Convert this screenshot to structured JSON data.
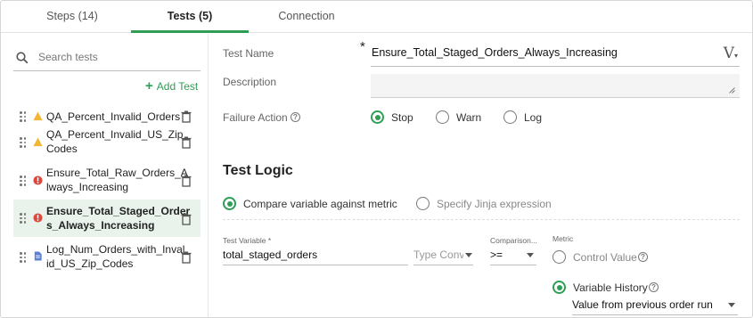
{
  "tabs": [
    {
      "label": "Steps (14)",
      "active": false
    },
    {
      "label": "Tests (5)",
      "active": true
    },
    {
      "label": "Connection",
      "active": false
    }
  ],
  "accent_color": "#2e9e55",
  "sidebar": {
    "search_placeholder": "Search tests",
    "add_test_label": "Add Test",
    "items": [
      {
        "line1": "QA_Percent_Invalid_Orders",
        "line2": "",
        "status": "warning",
        "selected": false
      },
      {
        "line1": "QA_Percent_Invalid_US_Zip_",
        "line2": "Codes",
        "status": "warning",
        "selected": false
      },
      {
        "line1": "Ensure_Total_Raw_Orders_A",
        "line2": "lways_Increasing",
        "status": "error",
        "selected": false
      },
      {
        "line1": "Ensure_Total_Staged_Order",
        "line2": "s_Always_Increasing",
        "status": "error",
        "selected": true
      },
      {
        "line1": "Log_Num_Orders_with_Inval",
        "line2": "id_US_Zip_Codes",
        "status": "document",
        "selected": false
      }
    ],
    "status_colors": {
      "warning": "#f2b632",
      "error": "#d94a3d",
      "document": "#5b7fd6"
    }
  },
  "form": {
    "test_name_label": "Test Name",
    "required_mark": "*",
    "test_name_value": "Ensure_Total_Staged_Orders_Always_Increasing",
    "variable_icon": "V",
    "description_label": "Description",
    "description_value": "",
    "failure_action_label": "Failure Action",
    "failure_actions": [
      {
        "label": "Stop",
        "selected": true
      },
      {
        "label": "Warn",
        "selected": false
      },
      {
        "label": "Log",
        "selected": false
      }
    ]
  },
  "logic": {
    "heading": "Test Logic",
    "modes": [
      {
        "label": "Compare variable against metric",
        "selected": true
      },
      {
        "label": "Specify Jinja expression",
        "selected": false
      }
    ],
    "test_variable_label": "Test Variable *",
    "test_variable_value": "total_staged_orders",
    "type_conversion_placeholder": "Type Conve",
    "comparison_label": "Comparison...",
    "comparison_value": ">=",
    "metric_label": "Metric",
    "metric_options": [
      {
        "label": "Control Value",
        "selected": false
      },
      {
        "label": "Variable History",
        "selected": true
      }
    ],
    "history_value": "Value from previous order run"
  }
}
